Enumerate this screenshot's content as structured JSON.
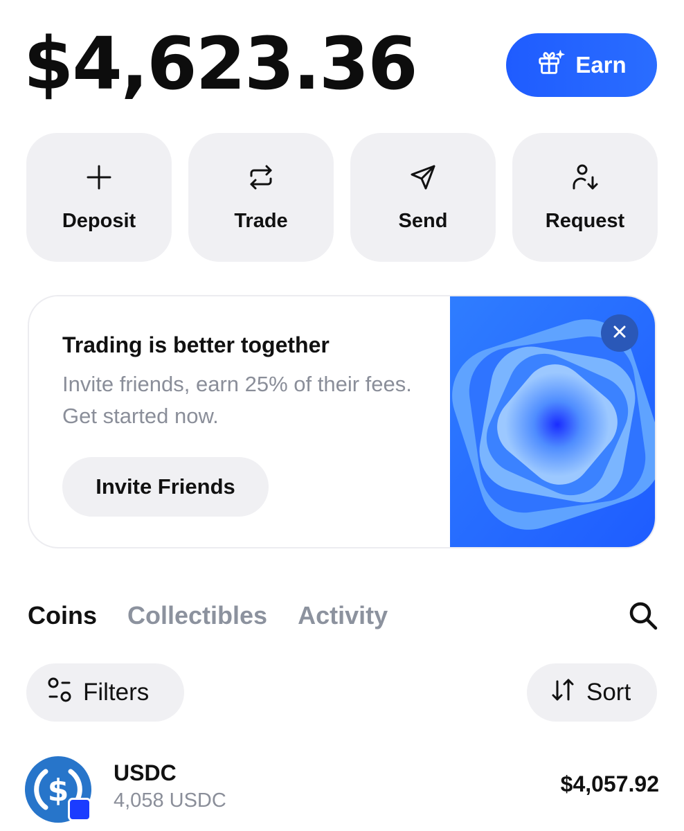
{
  "balance": "$4,623.36",
  "earn": {
    "label": "Earn",
    "icon": "gift-sparkle-icon",
    "color": "#1f5cff"
  },
  "actions": [
    {
      "label": "Deposit",
      "icon": "plus-icon"
    },
    {
      "label": "Trade",
      "icon": "swap-arrows-icon"
    },
    {
      "label": "Send",
      "icon": "paper-plane-icon"
    },
    {
      "label": "Request",
      "icon": "person-arrow-down-icon"
    }
  ],
  "promo": {
    "title": "Trading is better together",
    "text": "Invite friends, earn 25% of their fees. Get started now.",
    "button": "Invite Friends",
    "close_icon": "close-icon",
    "art_color": "#2a6dff"
  },
  "tabs": [
    {
      "label": "Coins",
      "active": true
    },
    {
      "label": "Collectibles",
      "active": false
    },
    {
      "label": "Activity",
      "active": false
    }
  ],
  "search_icon": "search-icon",
  "filters": {
    "label": "Filters",
    "icon": "filters-icon"
  },
  "sort": {
    "label": "Sort",
    "icon": "sort-arrows-icon"
  },
  "coins": [
    {
      "name": "USDC",
      "amount": "4,058 USDC",
      "value": "$4,057.92",
      "icon": "usdc-icon",
      "color": "#2775ca"
    }
  ]
}
